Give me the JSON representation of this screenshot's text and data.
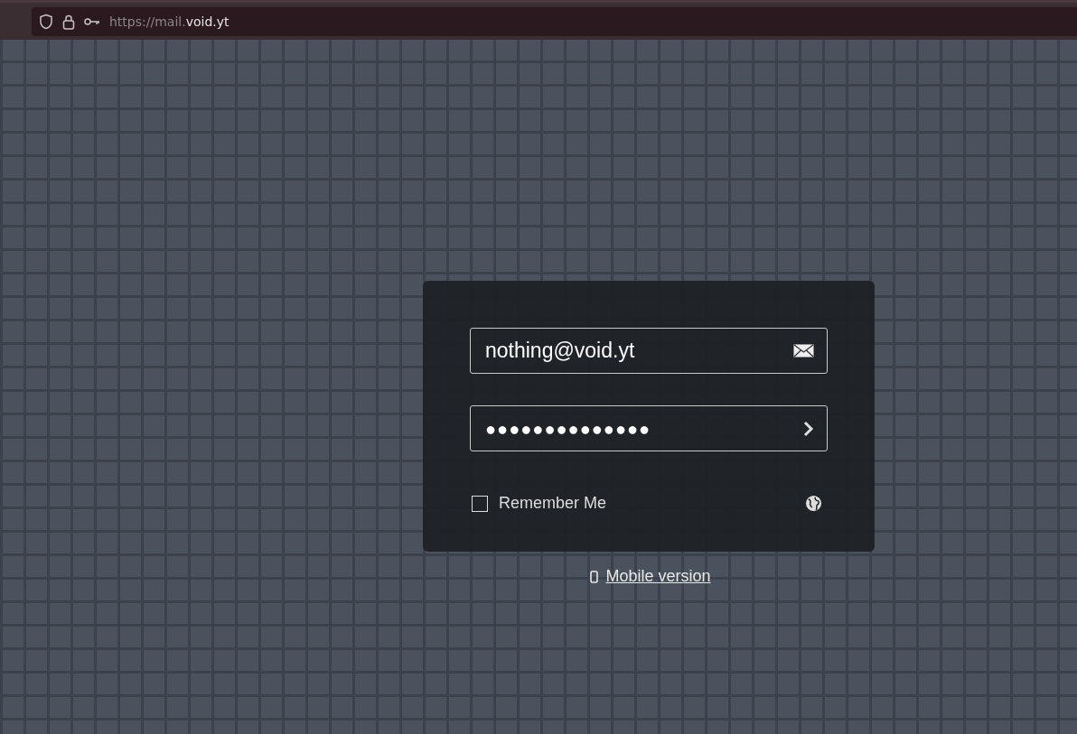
{
  "browser": {
    "url_scheme_host": "https://mail.",
    "url_domain": "void.yt"
  },
  "login": {
    "email": {
      "value": "nothing@void.yt"
    },
    "password": {
      "masked_value": "●●●●●●●●●●●●●●"
    },
    "remember_me": {
      "label": "Remember Me",
      "checked": false
    }
  },
  "mobile_link": {
    "label": "Mobile version"
  }
}
